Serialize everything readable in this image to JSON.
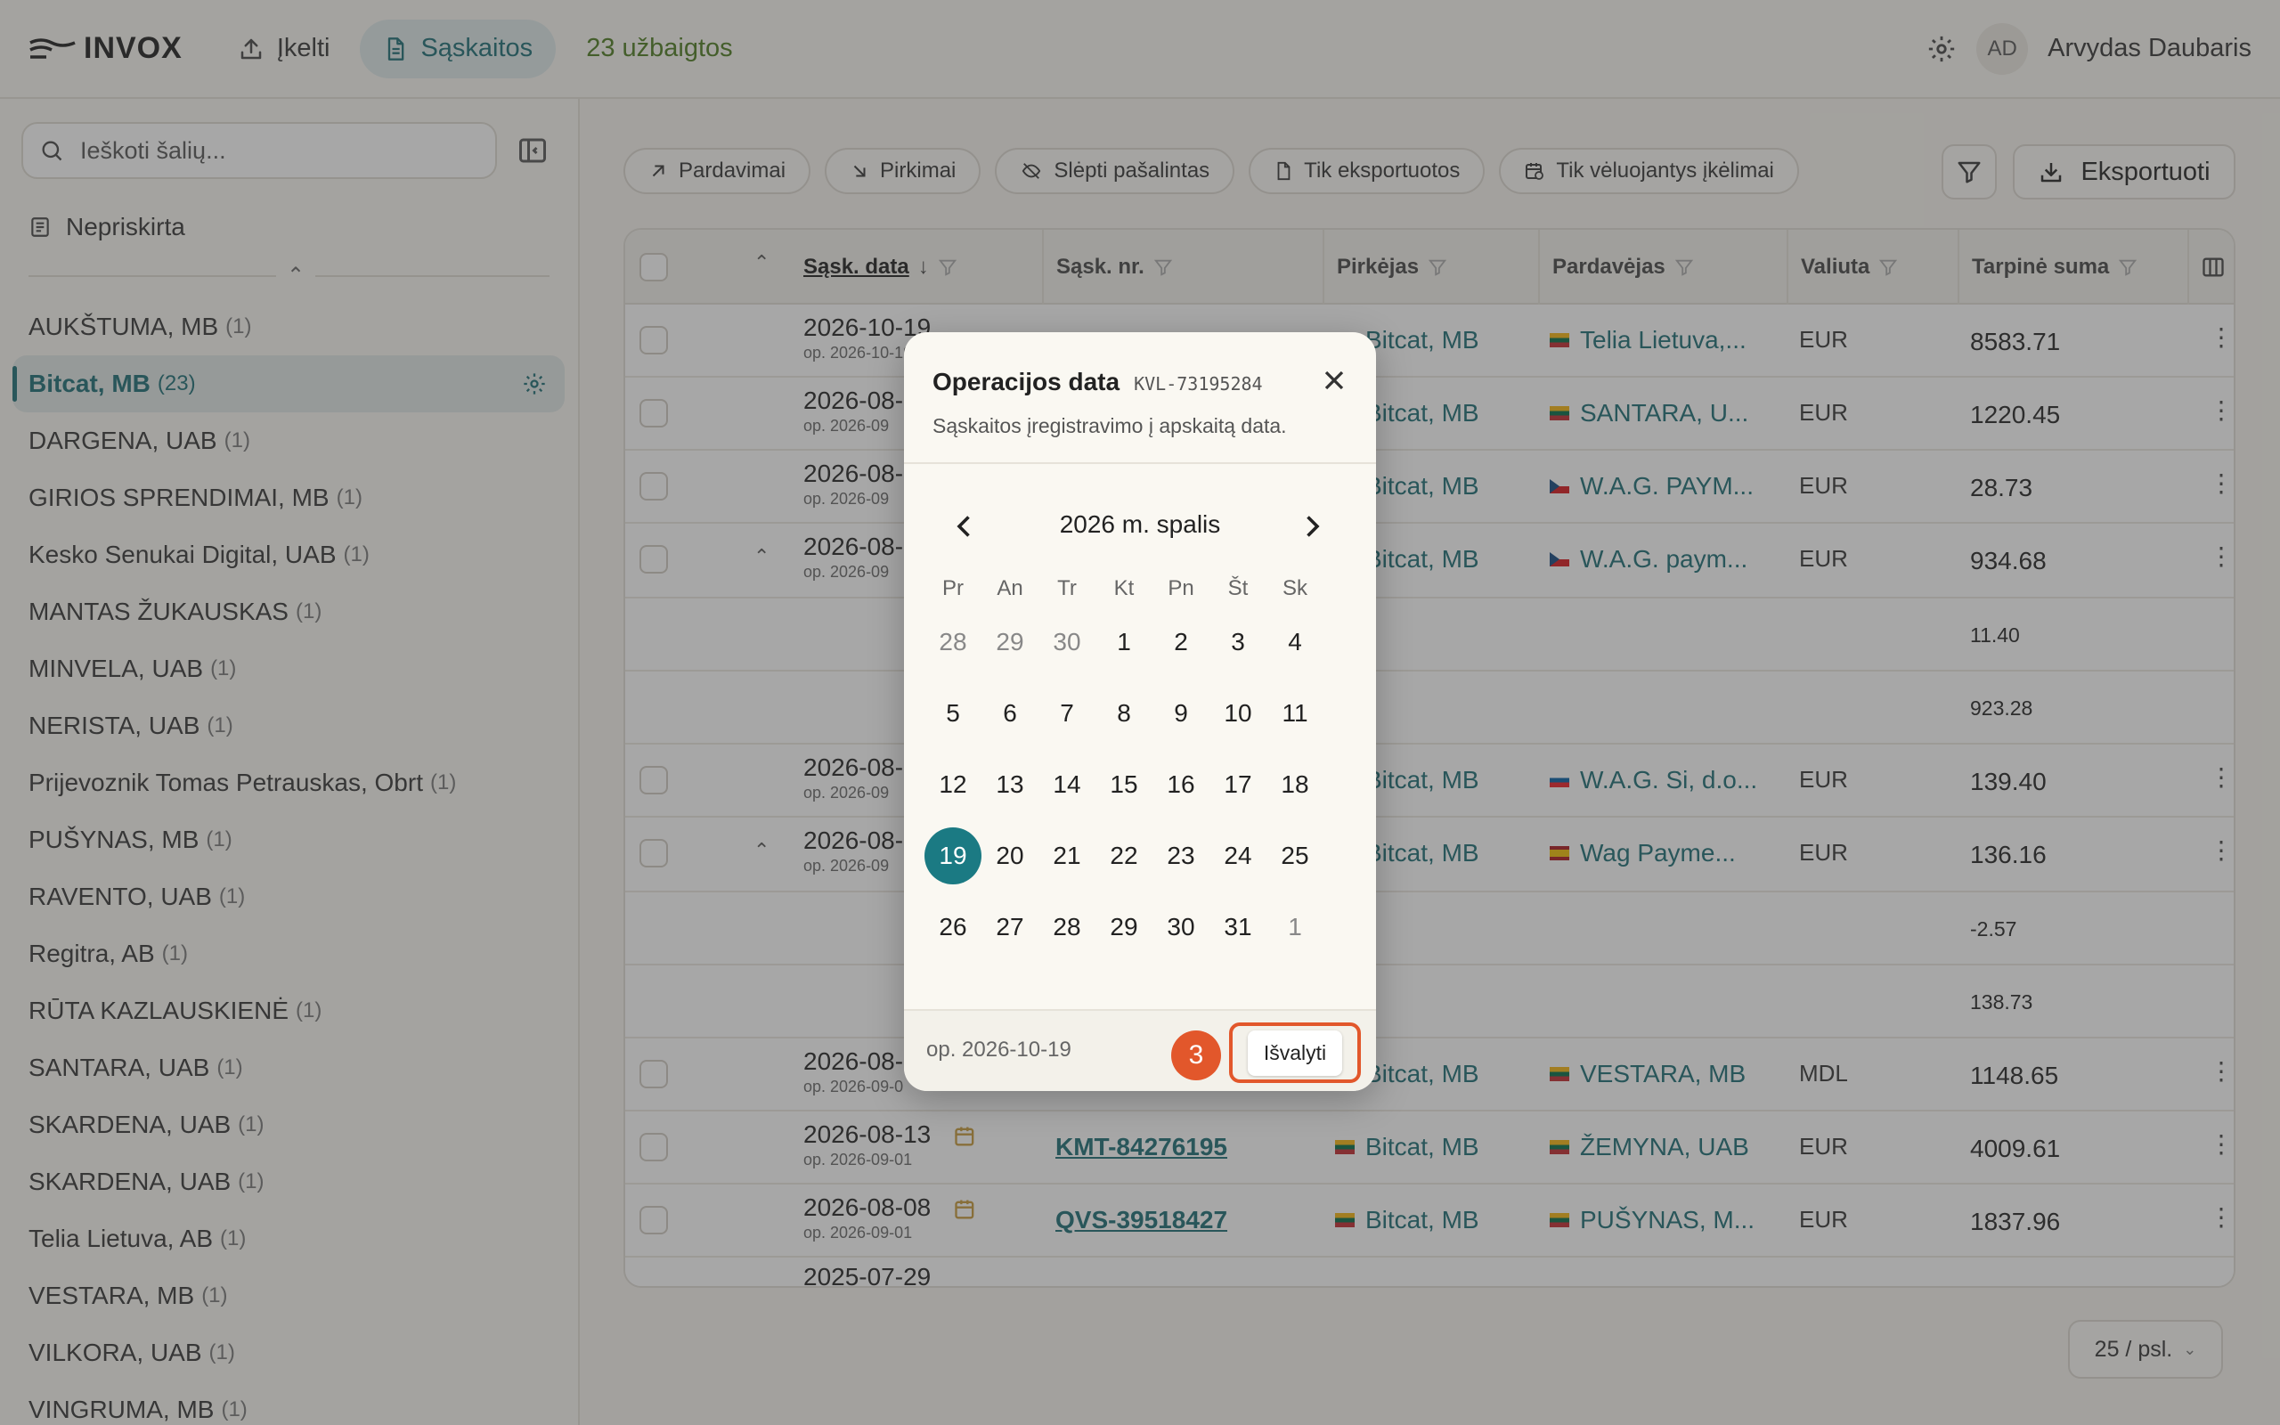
{
  "header": {
    "brand": "INVOX",
    "nav_upload": "Įkelti",
    "nav_invoices": "Sąskaitos",
    "completed": "23 užbaigtos",
    "user_initials": "AD",
    "user_name": "Arvydas Daubaris"
  },
  "sidebar": {
    "search_placeholder": "Ieškoti šalių...",
    "unassigned": "Nepriskirta",
    "parties": [
      {
        "name": "AUKŠTUMA, MB",
        "count": "(1)"
      },
      {
        "name": "Bitcat, MB",
        "count": "(23)",
        "active": true
      },
      {
        "name": "DARGENA, UAB",
        "count": "(1)"
      },
      {
        "name": "GIRIOS SPRENDIMAI, MB",
        "count": "(1)"
      },
      {
        "name": "Kesko Senukai Digital, UAB",
        "count": "(1)"
      },
      {
        "name": "MANTAS ŽUKAUSKAS",
        "count": "(1)"
      },
      {
        "name": "MINVELA, UAB",
        "count": "(1)"
      },
      {
        "name": "NERISTA, UAB",
        "count": "(1)"
      },
      {
        "name": "Prijevoznik Tomas Petrauskas, Obrt",
        "count": "(1)"
      },
      {
        "name": "PUŠYNAS, MB",
        "count": "(1)"
      },
      {
        "name": "RAVENTO, UAB",
        "count": "(1)"
      },
      {
        "name": "Regitra, AB",
        "count": "(1)"
      },
      {
        "name": "RŪTA KAZLAUSKIENĖ",
        "count": "(1)"
      },
      {
        "name": "SANTARA, UAB",
        "count": "(1)"
      },
      {
        "name": "SKARDENA, UAB",
        "count": "(1)"
      },
      {
        "name": "SKARDENA, UAB",
        "count": "(1)"
      },
      {
        "name": "Telia Lietuva, AB",
        "count": "(1)"
      },
      {
        "name": "VESTARA, MB",
        "count": "(1)"
      },
      {
        "name": "VILKORA, UAB",
        "count": "(1)"
      },
      {
        "name": "VINGRUMA, MB",
        "count": "(1)"
      }
    ]
  },
  "toolbar": {
    "sales": "Pardavimai",
    "purchases": "Pirkimai",
    "hide_removed": "Slėpti pašalintas",
    "only_exported": "Tik eksportuotos",
    "only_late": "Tik vėluojantys įkėlimai",
    "export": "Eksportuoti"
  },
  "table": {
    "columns": {
      "date": "Sąsk. data",
      "number": "Sąsk. nr.",
      "buyer": "Pirkėjas",
      "seller": "Pardavėjas",
      "currency": "Valiuta",
      "subtotal": "Tarpinė suma"
    },
    "rows": [
      {
        "date": "2026-10-19",
        "sub": "op. 2026-10-19",
        "buyer": "Bitcat, MB",
        "seller": "Telia Lietuva,...",
        "flag": "lt",
        "currency": "EUR",
        "amount": "8583.71"
      },
      {
        "date": "2026-08-",
        "sub": "op. 2026-09",
        "buyer": "Bitcat, MB",
        "seller": "SANTARA, U...",
        "flag": "lt",
        "currency": "EUR",
        "amount": "1220.45"
      },
      {
        "date": "2026-08-",
        "sub": "op. 2026-09",
        "buyer": "Bitcat, MB",
        "seller": "W.A.G. PAYM...",
        "flag": "cz",
        "currency": "EUR",
        "amount": "28.73"
      },
      {
        "date": "2026-08-",
        "sub": "op. 2026-09",
        "buyer": "Bitcat, MB",
        "seller": "W.A.G. paym...",
        "flag": "cz",
        "currency": "EUR",
        "amount": "934.68",
        "expand": true
      },
      {
        "amount": "11.40"
      },
      {
        "amount": "923.28"
      },
      {
        "date": "2026-08-",
        "sub": "op. 2026-09",
        "buyer": "Bitcat, MB",
        "seller": "W.A.G. Si, d.o...",
        "flag": "si",
        "currency": "EUR",
        "amount": "139.40"
      },
      {
        "date": "2026-08-",
        "sub": "op. 2026-09",
        "buyer": "Bitcat, MB",
        "seller": "Wag Payme...",
        "flag": "es",
        "currency": "EUR",
        "amount": "136.16",
        "expand": true
      },
      {
        "amount": "-2.57"
      },
      {
        "amount": "138.73"
      },
      {
        "date": "2026-08-",
        "sub": "op. 2026-09-0",
        "buyer": "Bitcat, MB",
        "seller": "VESTARA, MB",
        "flag": "lt",
        "currency": "MDL",
        "amount": "1148.65"
      },
      {
        "date": "2026-08-13",
        "sub": "op. 2026-09-01",
        "number": "KMT-84276195",
        "buyer": "Bitcat, MB",
        "seller": "ŽEMYNA, UAB",
        "flag": "lt",
        "currency": "EUR",
        "amount": "4009.61"
      },
      {
        "date": "2026-08-08",
        "sub": "op. 2026-09-01",
        "number": "QVS-39518427",
        "buyer": "Bitcat, MB",
        "seller": "PUŠYNAS, M...",
        "flag": "lt",
        "currency": "EUR",
        "amount": "1837.96"
      }
    ],
    "partial_date": "2025-07-29"
  },
  "pagination": {
    "per_page": "25 / psl."
  },
  "popover": {
    "title": "Operacijos data",
    "code": "KVL-73195284",
    "description": "Sąskaitos įregistravimo į apskaitą data.",
    "month": "2026 m. spalis",
    "weekdays": [
      "Pr",
      "An",
      "Tr",
      "Kt",
      "Pn",
      "Št",
      "Sk"
    ],
    "days": [
      {
        "d": "28",
        "m": true
      },
      {
        "d": "29",
        "m": true
      },
      {
        "d": "30",
        "m": true
      },
      {
        "d": "1"
      },
      {
        "d": "2"
      },
      {
        "d": "3"
      },
      {
        "d": "4"
      },
      {
        "d": "5"
      },
      {
        "d": "6"
      },
      {
        "d": "7"
      },
      {
        "d": "8"
      },
      {
        "d": "9"
      },
      {
        "d": "10"
      },
      {
        "d": "11"
      },
      {
        "d": "12"
      },
      {
        "d": "13"
      },
      {
        "d": "14"
      },
      {
        "d": "15"
      },
      {
        "d": "16"
      },
      {
        "d": "17"
      },
      {
        "d": "18"
      },
      {
        "d": "19",
        "s": true
      },
      {
        "d": "20"
      },
      {
        "d": "21"
      },
      {
        "d": "22"
      },
      {
        "d": "23"
      },
      {
        "d": "24"
      },
      {
        "d": "25"
      },
      {
        "d": "26"
      },
      {
        "d": "27"
      },
      {
        "d": "28"
      },
      {
        "d": "29"
      },
      {
        "d": "30"
      },
      {
        "d": "31"
      },
      {
        "d": "1",
        "m": true
      }
    ],
    "footer_date": "op. 2026-10-19",
    "step": "3",
    "clear": "Išvalyti"
  }
}
